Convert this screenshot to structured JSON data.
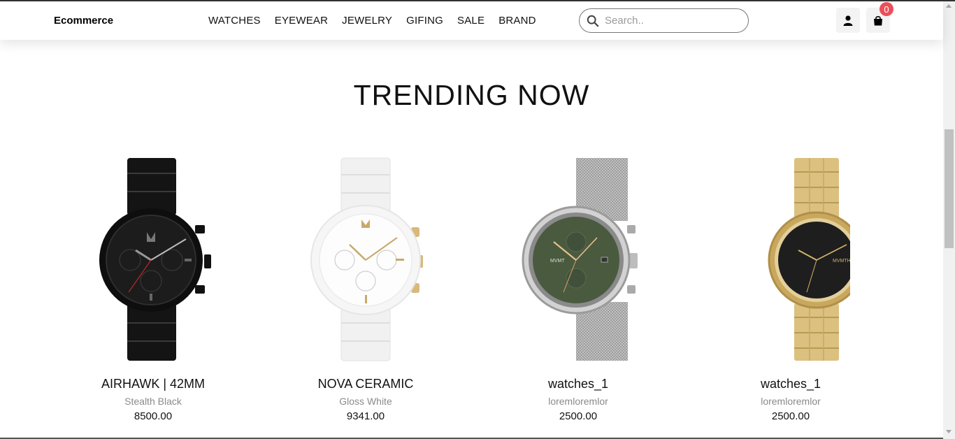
{
  "brand": "Ecommerce",
  "nav": [
    "WATCHES",
    "EYEWEAR",
    "JEWELRY",
    "GIFING",
    "SALE",
    "BRAND"
  ],
  "search": {
    "placeholder": "Search.."
  },
  "cart": {
    "count": "0"
  },
  "section_title": "TRENDING NOW",
  "products": [
    {
      "name": "AIRHAWK | 42MM",
      "subtitle": "Stealth Black",
      "price": "8500.00"
    },
    {
      "name": "NOVA CERAMIC",
      "subtitle": "Gloss White",
      "price": "9341.00"
    },
    {
      "name": "watches_1",
      "subtitle": "loremloremlor",
      "price": "2500.00"
    },
    {
      "name": "watches_1",
      "subtitle": "loremloremlor",
      "price": "2500.00"
    }
  ],
  "colors": {
    "badge": "#e8505b",
    "black_watch": "#1a1a1a",
    "white_watch": "#f4f4f4",
    "silver_watch": "#b9b9b9",
    "green_dial": "#4a5a3f",
    "gold_watch": "#d4b46a"
  }
}
